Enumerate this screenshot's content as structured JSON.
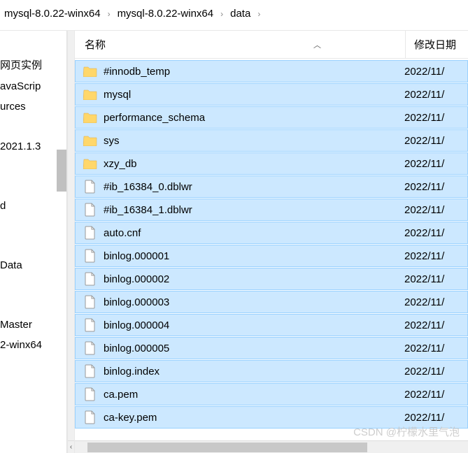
{
  "breadcrumb": {
    "crumb0": "mysql-8.0.22-winx64",
    "crumb1": "mysql-8.0.22-winx64",
    "crumb2": "data"
  },
  "columns": {
    "name": "名称",
    "date": "修改日期"
  },
  "sidebar": {
    "items": [
      {
        "label": ""
      },
      {
        "label": "网页实例"
      },
      {
        "label": "avaScrip"
      },
      {
        "label": "urces"
      },
      {
        "label": ""
      },
      {
        "label": " 2021.1.3"
      },
      {
        "label": ""
      },
      {
        "label": ""
      },
      {
        "label": "d"
      },
      {
        "label": ""
      },
      {
        "label": ""
      },
      {
        "label": "Data"
      },
      {
        "label": ""
      },
      {
        "label": ""
      },
      {
        "label": "Master"
      },
      {
        "label": "2-winx64"
      }
    ]
  },
  "files": [
    {
      "name": "#innodb_temp",
      "type": "folder",
      "date": "2022/11/"
    },
    {
      "name": "mysql",
      "type": "folder",
      "date": "2022/11/"
    },
    {
      "name": "performance_schema",
      "type": "folder",
      "date": "2022/11/"
    },
    {
      "name": "sys",
      "type": "folder",
      "date": "2022/11/"
    },
    {
      "name": "xzy_db",
      "type": "folder",
      "date": "2022/11/"
    },
    {
      "name": "#ib_16384_0.dblwr",
      "type": "file",
      "date": "2022/11/"
    },
    {
      "name": "#ib_16384_1.dblwr",
      "type": "file",
      "date": "2022/11/"
    },
    {
      "name": "auto.cnf",
      "type": "file",
      "date": "2022/11/"
    },
    {
      "name": "binlog.000001",
      "type": "file",
      "date": "2022/11/"
    },
    {
      "name": "binlog.000002",
      "type": "file",
      "date": "2022/11/"
    },
    {
      "name": "binlog.000003",
      "type": "file",
      "date": "2022/11/"
    },
    {
      "name": "binlog.000004",
      "type": "file",
      "date": "2022/11/"
    },
    {
      "name": "binlog.000005",
      "type": "file",
      "date": "2022/11/"
    },
    {
      "name": "binlog.index",
      "type": "file",
      "date": "2022/11/"
    },
    {
      "name": "ca.pem",
      "type": "file",
      "date": "2022/11/"
    },
    {
      "name": "ca-key.pem",
      "type": "file",
      "date": "2022/11/"
    }
  ],
  "watermark": "CSDN @柠檬水里气泡"
}
